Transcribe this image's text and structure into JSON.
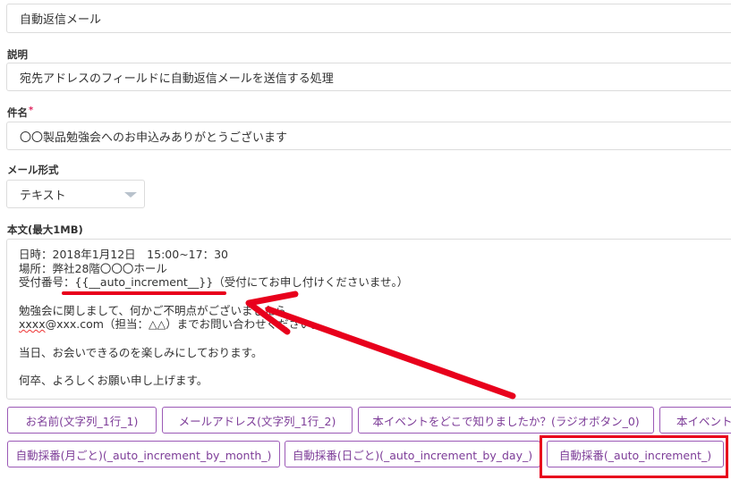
{
  "form": {
    "name_value": "自動返信メール",
    "description_label": "説明",
    "description_value": "宛先アドレスのフィールドに自動返信メールを送信する処理",
    "subject_label": "件名",
    "subject_required": "*",
    "subject_value": "〇〇製品勉強会へのお申込みありがとうございます",
    "mail_format_label": "メール形式",
    "mail_format_value": "テキスト",
    "body_label": "本文(最大1MB)",
    "body_lines": {
      "l1": "日時：2018年1月12日　15:00~17：30",
      "l2": "場所：弊社28階〇〇〇ホール",
      "l3": "受付番号：{{__auto_increment__}}（受付にてお申し付けくださいませ。）",
      "l4": "勉強会に関しまして、何かご不明点がございましたら",
      "l5a": "xxxx",
      "l5b": "@xxx.com（担当：△△）までお問い合わせください。",
      "l6": "当日、お会いできるのを楽しみにしております。",
      "l7": "何卒、よろしくお願い申し上げます。"
    }
  },
  "insert_buttons": {
    "row1": [
      "お名前(文字列_1行_1)",
      "メールアドレス(文字列_1行_2)",
      "本イベントをどこで知りましたか？(ラジオボタン_0)",
      "本イベント"
    ],
    "row2": [
      "自動採番(月ごと)(_auto_increment_by_month_)",
      "自動採番(日ごと)(_auto_increment_by_day_)",
      "自動採番(_auto_increment_)"
    ]
  },
  "colors": {
    "annotation_red": "#e8001c",
    "button_purple": "#9b59b6"
  }
}
